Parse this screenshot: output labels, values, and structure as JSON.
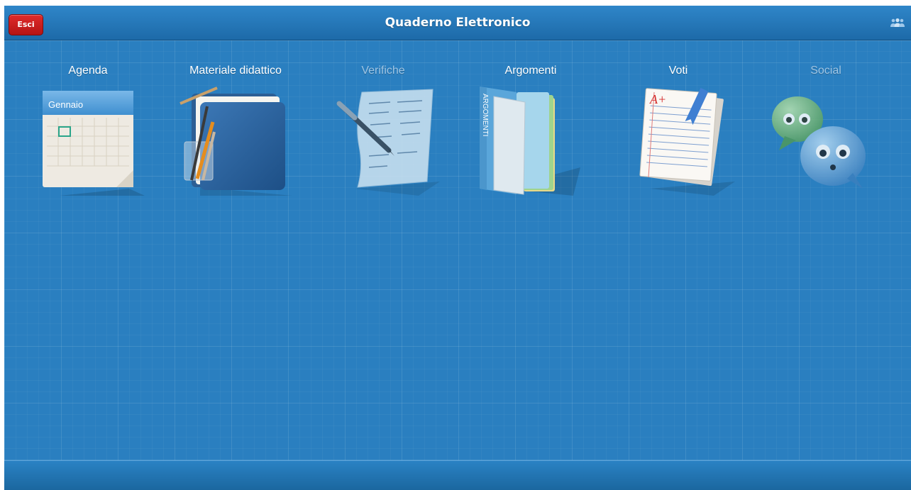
{
  "header": {
    "exit_label": "Esci",
    "title": "Quaderno Elettronico",
    "users_icon": "users-icon"
  },
  "tiles": [
    {
      "label": "Agenda",
      "icon": "calendar-icon",
      "enabled": true,
      "calendar_month": "Gennaio"
    },
    {
      "label": "Materiale didattico",
      "icon": "folder-pencils-icon",
      "enabled": true
    },
    {
      "label": "Verifiche",
      "icon": "test-paper-pen-icon",
      "enabled": false
    },
    {
      "label": "Argomenti",
      "icon": "folders-icon",
      "enabled": true,
      "folder_text": "ARGOMENTI"
    },
    {
      "label": "Voti",
      "icon": "graded-paper-icon",
      "enabled": true,
      "grade": "A+"
    },
    {
      "label": "Social",
      "icon": "chat-bubbles-icon",
      "enabled": false
    }
  ],
  "colors": {
    "background": "#2a7fc0",
    "header": "#1d6aa8",
    "exit_button": "#c81e1e",
    "disabled_label": "#9ec5e5"
  }
}
